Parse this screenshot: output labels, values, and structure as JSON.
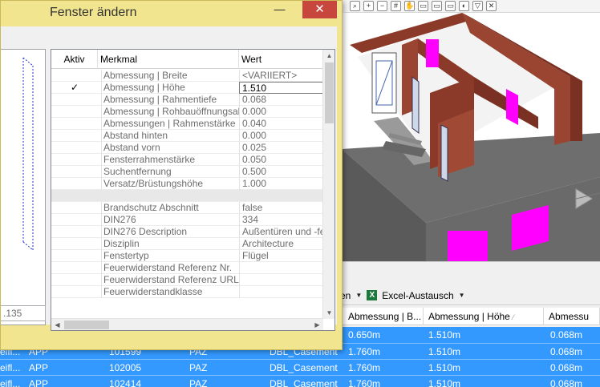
{
  "dialog": {
    "title": "Fenster ändern",
    "minimize_label": "—",
    "close_label": "✕",
    "left_value": ".135"
  },
  "grid": {
    "columns": [
      "Aktiv",
      "Merkmal",
      "Wert"
    ],
    "rows": [
      {
        "active": "",
        "name": "Abmessung | Breite",
        "value": "<VARIIERT>"
      },
      {
        "active": "✓",
        "name": "Abmessung | Höhe",
        "value": "1.510",
        "selected": true
      },
      {
        "active": "",
        "name": "Abmessung | Rahmentiefe",
        "value": "0.068"
      },
      {
        "active": "",
        "name": "Abmessung | Rohbauöffnungsabs...",
        "value": "0.000"
      },
      {
        "active": "",
        "name": "Abmessungen | Rahmenstärke",
        "value": "0.040"
      },
      {
        "active": "",
        "name": "Abstand hinten",
        "value": "0.000"
      },
      {
        "active": "",
        "name": "Abstand vorn",
        "value": "0.025"
      },
      {
        "active": "",
        "name": "Fensterrahmenstärke",
        "value": "0.050"
      },
      {
        "active": "",
        "name": "Suchentfernung",
        "value": "0.500"
      },
      {
        "active": "",
        "name": "Versatz/Brüstungshöhe",
        "value": "1.000"
      },
      {
        "separator": true
      },
      {
        "active": "",
        "name": "Brandschutz Abschnitt",
        "value": "false"
      },
      {
        "active": "",
        "name": "DIN276",
        "value": "334"
      },
      {
        "active": "",
        "name": "DIN276 Description",
        "value": "Außentüren und -fenster"
      },
      {
        "active": "",
        "name": "Disziplin",
        "value": "Architecture"
      },
      {
        "active": "",
        "name": "Fenstertyp",
        "value": "Flügel"
      },
      {
        "active": "",
        "name": "Feuerwiderstand Referenz Nr.",
        "value": ""
      },
      {
        "active": "",
        "name": "Feuerwiderstand Referenz URL",
        "value": ""
      },
      {
        "active": "",
        "name": "Feuerwiderstandklasse",
        "value": ""
      }
    ]
  },
  "background": {
    "toolbar_icons": [
      "magnify-icon",
      "zoom-in-icon",
      "zoom-out-icon",
      "grid-icon",
      "hand-icon",
      "window-icon",
      "window-icon",
      "window-icon",
      "view-icon",
      "funnel-icon",
      "close-icon"
    ],
    "panel_toolbar": {
      "truncated_label": "en",
      "excel_label": "Excel-Austausch"
    },
    "header": [
      "Abmessung | B...",
      "Abmessung | Höhe",
      "Abmessu"
    ],
    "rows": [
      {
        "c1": "",
        "c2": "",
        "c3": "",
        "c4": "",
        "c5": "",
        "breite": "0.650m",
        "hoehe": "1.510m",
        "abm": "0.068m"
      },
      {
        "c1": "eifl...",
        "c2": "APP",
        "c3": "101599",
        "c4": "PAZ",
        "c5": "DBL_Casement",
        "breite": "1.760m",
        "hoehe": "1.510m",
        "abm": "0.068m"
      },
      {
        "c1": "eifl...",
        "c2": "APP",
        "c3": "102005",
        "c4": "PAZ",
        "c5": "DBL_Casement",
        "breite": "1.760m",
        "hoehe": "1.510m",
        "abm": "0.068m"
      },
      {
        "c1": "eifl...",
        "c2": "APP",
        "c3": "102414",
        "c4": "PAZ",
        "c5": "DBL_Casement",
        "breite": "1.760m",
        "hoehe": "1.510m",
        "abm": "0.068m"
      }
    ]
  },
  "colors": {
    "dialog_frame": "#f1e58f",
    "close_button": "#c7463d",
    "selection": "#3399ff",
    "brick": "#8b3a2a",
    "window_magenta": "#ff00ff"
  }
}
